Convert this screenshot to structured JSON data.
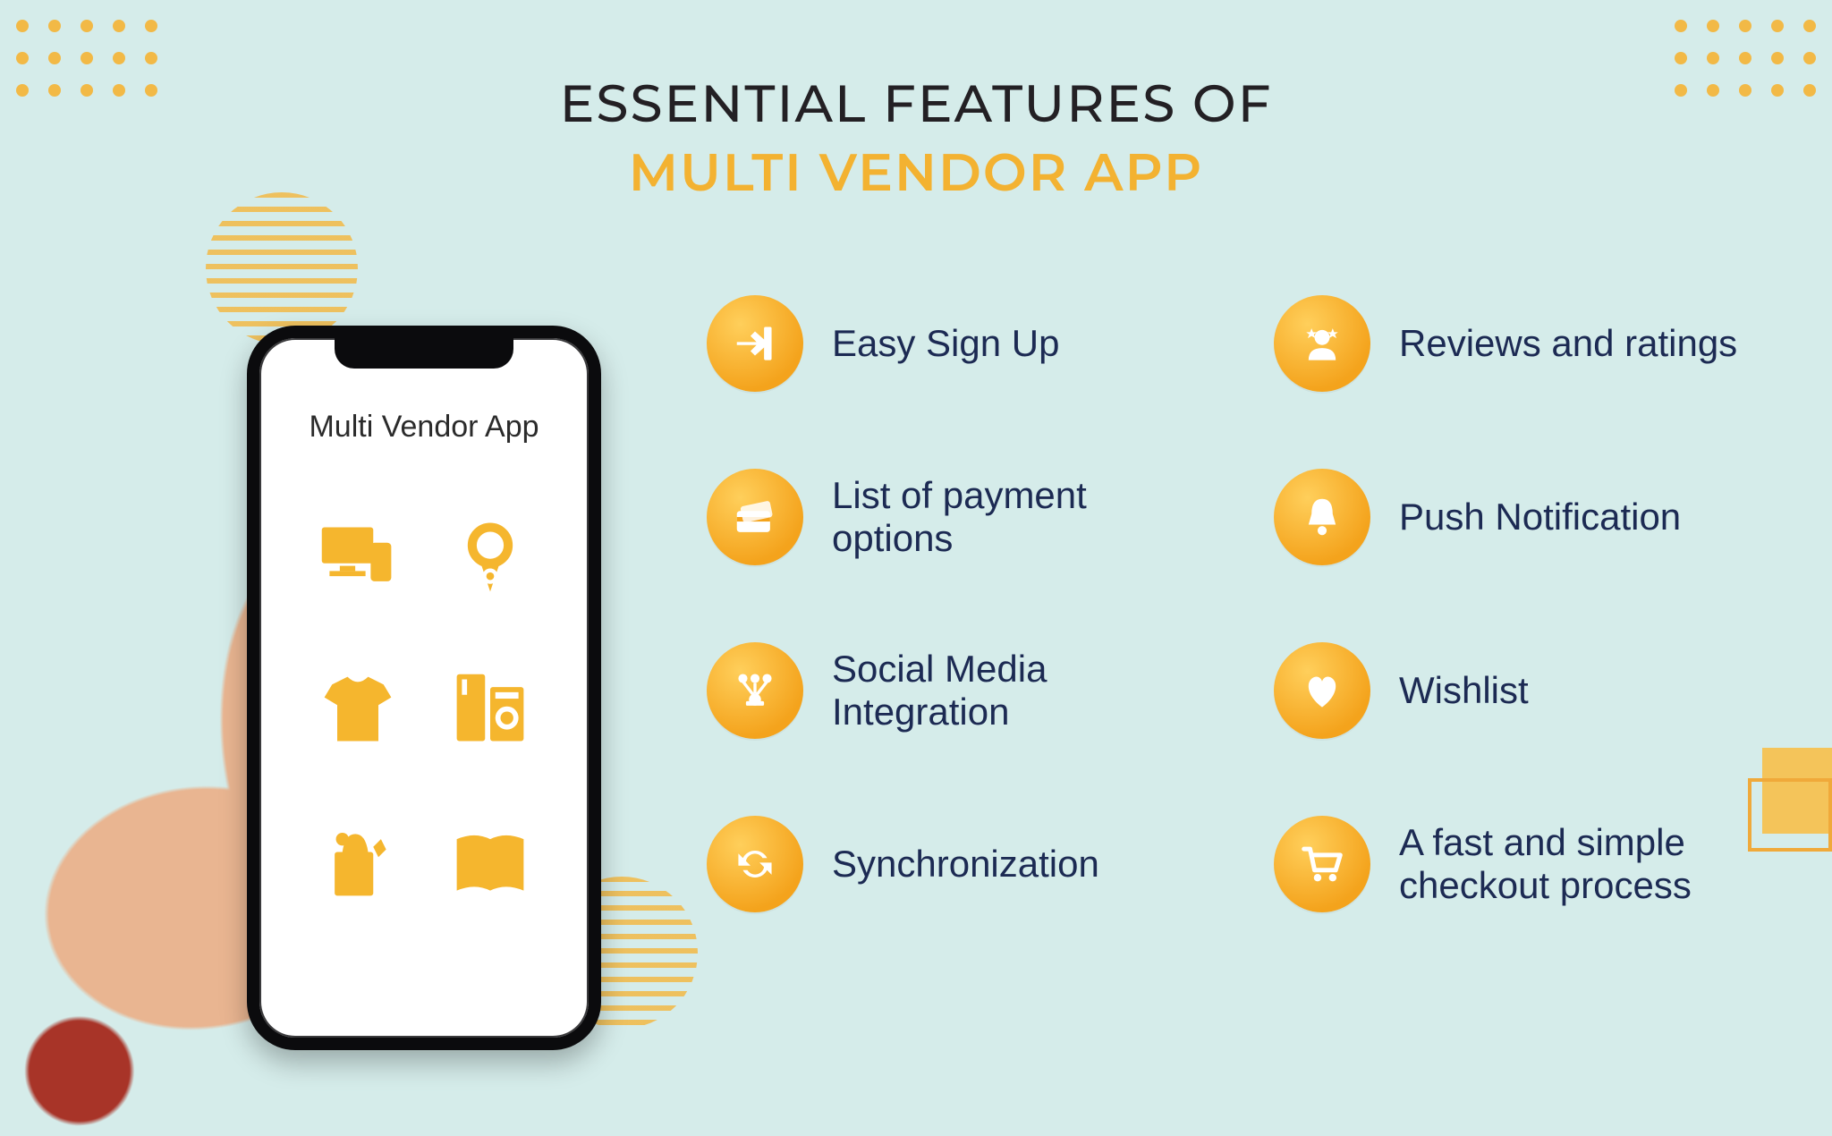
{
  "title": {
    "line1": "ESSENTIAL FEATURES OF",
    "line2": "MULTI VENDOR APP"
  },
  "phone": {
    "app_title": "Multi Vendor App",
    "categories": [
      {
        "name": "electronics-icon"
      },
      {
        "name": "jewelry-icon"
      },
      {
        "name": "tshirt-icon"
      },
      {
        "name": "appliance-icon"
      },
      {
        "name": "grocery-icon"
      },
      {
        "name": "book-icon"
      }
    ]
  },
  "features_left": [
    {
      "icon": "login-icon",
      "label": "Easy Sign Up"
    },
    {
      "icon": "payment-icon",
      "label": "List of payment options"
    },
    {
      "icon": "share-icon",
      "label": "Social Media Integration"
    },
    {
      "icon": "sync-icon",
      "label": "Synchronization"
    }
  ],
  "features_right": [
    {
      "icon": "reviewer-icon",
      "label": "Reviews and ratings"
    },
    {
      "icon": "bell-icon",
      "label": "Push Notification"
    },
    {
      "icon": "heart-icon",
      "label": "Wishlist"
    },
    {
      "icon": "cart-icon",
      "label": "A fast and simple checkout process"
    }
  ]
}
